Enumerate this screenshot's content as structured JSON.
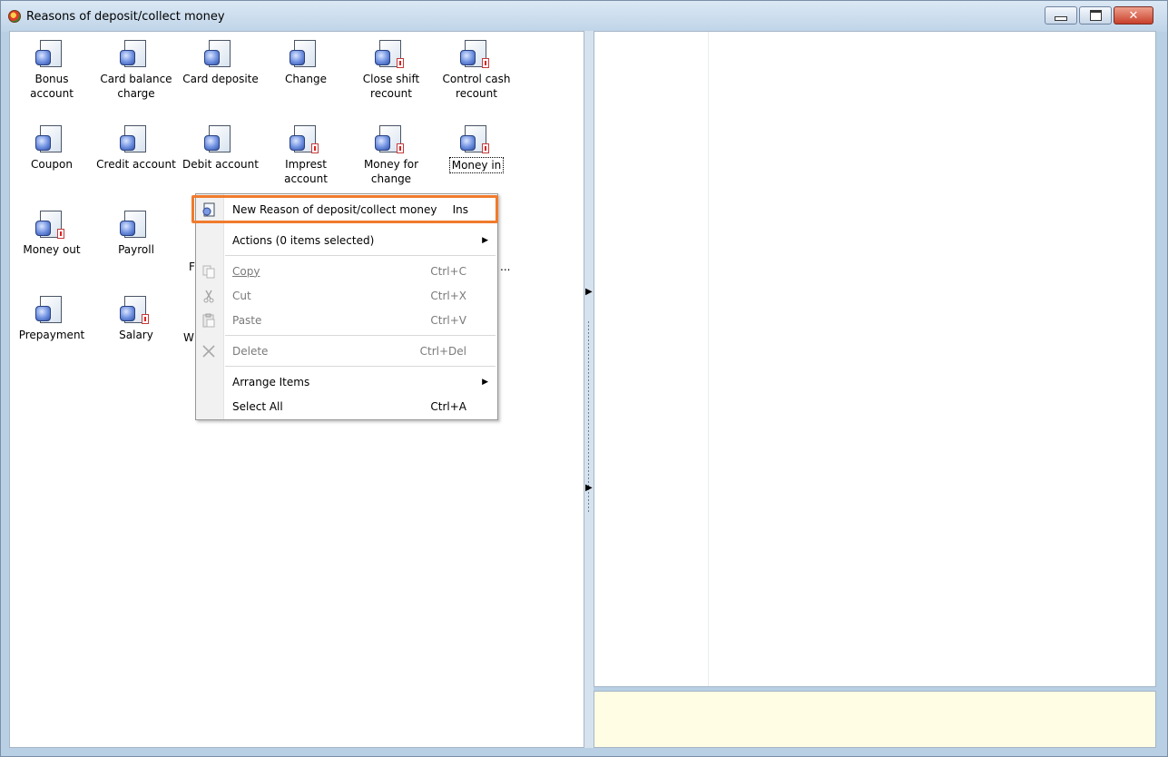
{
  "window": {
    "title": "Reasons of deposit/collect money",
    "controls": {
      "minimize": "minimize-icon",
      "maximize": "maximize-icon",
      "close": "close-icon",
      "close_glyph": "✕"
    }
  },
  "items": [
    {
      "label": "Bonus account",
      "line1": "Bonus",
      "line2": "account",
      "flag": false
    },
    {
      "label": "Card balance charge",
      "line1": "Card balance",
      "line2": "charge",
      "flag": false
    },
    {
      "label": "Card deposite",
      "line1": "Card deposite",
      "line2": "",
      "flag": false
    },
    {
      "label": "Change",
      "line1": "Change",
      "line2": "",
      "flag": false
    },
    {
      "label": "Close shift recount",
      "line1": "Close shift",
      "line2": "recount",
      "flag": true
    },
    {
      "label": "Control cash recount",
      "line1": "Control cash",
      "line2": "recount",
      "flag": true
    },
    {
      "label": "Coupon",
      "line1": "Coupon",
      "line2": "",
      "flag": false
    },
    {
      "label": "Credit account",
      "line1": "Credit account",
      "line2": "",
      "flag": false
    },
    {
      "label": "Debit account",
      "line1": "Debit account",
      "line2": "",
      "flag": false
    },
    {
      "label": "Imprest account",
      "line1": "Imprest",
      "line2": "account",
      "flag": true
    },
    {
      "label": "Money for change",
      "line1": "Money for",
      "line2": "change",
      "flag": true
    },
    {
      "label": "Money in",
      "line1": "Money in",
      "line2": "",
      "flag": true,
      "selected": true
    },
    {
      "label": "Money out",
      "line1": "Money out",
      "line2": "",
      "flag": true
    },
    {
      "label": "Payroll",
      "line1": "Payroll",
      "line2": "",
      "flag": false
    },
    {
      "label": "Prepayment",
      "line1": "Prepayment",
      "line2": "",
      "flag": false
    },
    {
      "label": "Salary",
      "line1": "Salary",
      "line2": "",
      "flag": true
    }
  ],
  "partial_labels": {
    "row3_col3": "F",
    "row4_col3": "W",
    "row3_ellipsis": "..."
  },
  "context_menu": {
    "new_reason": {
      "label": "New Reason of deposit/collect money",
      "shortcut": "Ins"
    },
    "actions": {
      "label": "Actions (0 items selected)"
    },
    "copy": {
      "label": "Copy",
      "shortcut": "Ctrl+C"
    },
    "cut": {
      "label": "Cut",
      "shortcut": "Ctrl+X"
    },
    "paste": {
      "label": "Paste",
      "shortcut": "Ctrl+V"
    },
    "delete": {
      "label": "Delete",
      "shortcut": "Ctrl+Del"
    },
    "arrange": {
      "label": "Arrange Items"
    },
    "select_all": {
      "label": "Select All",
      "shortcut": "Ctrl+A"
    }
  },
  "colors": {
    "highlight": "#f07b2c",
    "info_panel": "#fffde3"
  }
}
